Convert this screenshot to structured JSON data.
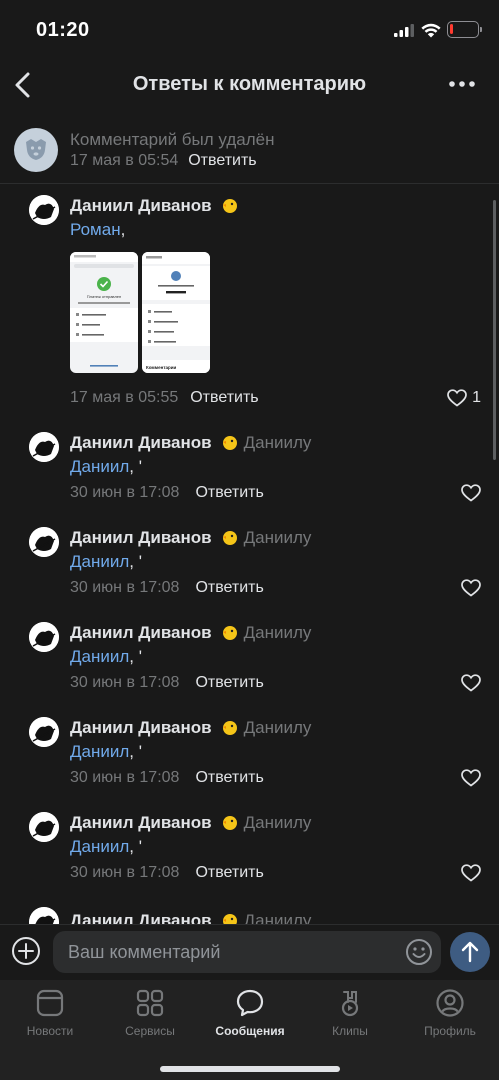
{
  "status": {
    "time": "01:20"
  },
  "header": {
    "title": "Ответы к комментарию"
  },
  "parent": {
    "text": "Комментарий был удалён",
    "date": "17 мая в 05:54",
    "reply": "Ответить"
  },
  "comments": [
    {
      "author": "Даниил Диванов",
      "to": "",
      "mention": "Роман",
      "text_rest": ",",
      "date": "17 мая в 05:55",
      "reply": "Ответить",
      "likes": "1",
      "screen1_title": "Платеж отправлен",
      "screen2_title": "Комментарии"
    },
    {
      "author": "Даниил Диванов",
      "to": "Даниилу",
      "mention": "Даниил",
      "text_rest": ", '",
      "date": "30 июн в 17:08",
      "reply": "Ответить"
    },
    {
      "author": "Даниил Диванов",
      "to": "Даниилу",
      "mention": "Даниил",
      "text_rest": ", '",
      "date": "30 июн в 17:08",
      "reply": "Ответить"
    },
    {
      "author": "Даниил Диванов",
      "to": "Даниилу",
      "mention": "Даниил",
      "text_rest": ", '",
      "date": "30 июн в 17:08",
      "reply": "Ответить"
    },
    {
      "author": "Даниил Диванов",
      "to": "Даниилу",
      "mention": "Даниил",
      "text_rest": ", '",
      "date": "30 июн в 17:08",
      "reply": "Ответить"
    },
    {
      "author": "Даниил Диванов",
      "to": "Даниилу",
      "mention": "Даниил",
      "text_rest": ", '",
      "date": "30 июн в 17:08",
      "reply": "Ответить"
    },
    {
      "author": "Даниил Диванов",
      "to": "Даниилу"
    }
  ],
  "input": {
    "placeholder": "Ваш комментарий"
  },
  "tabs": [
    {
      "label": "Новости",
      "icon": "news-icon"
    },
    {
      "label": "Сервисы",
      "icon": "services-icon"
    },
    {
      "label": "Сообщения",
      "icon": "messages-icon"
    },
    {
      "label": "Клипы",
      "icon": "clips-icon"
    },
    {
      "label": "Профиль",
      "icon": "profile-icon"
    }
  ],
  "colors": {
    "background": "#191919",
    "link": "#71aaeb",
    "secondary": "#76787a",
    "send": "#3e5c82"
  }
}
